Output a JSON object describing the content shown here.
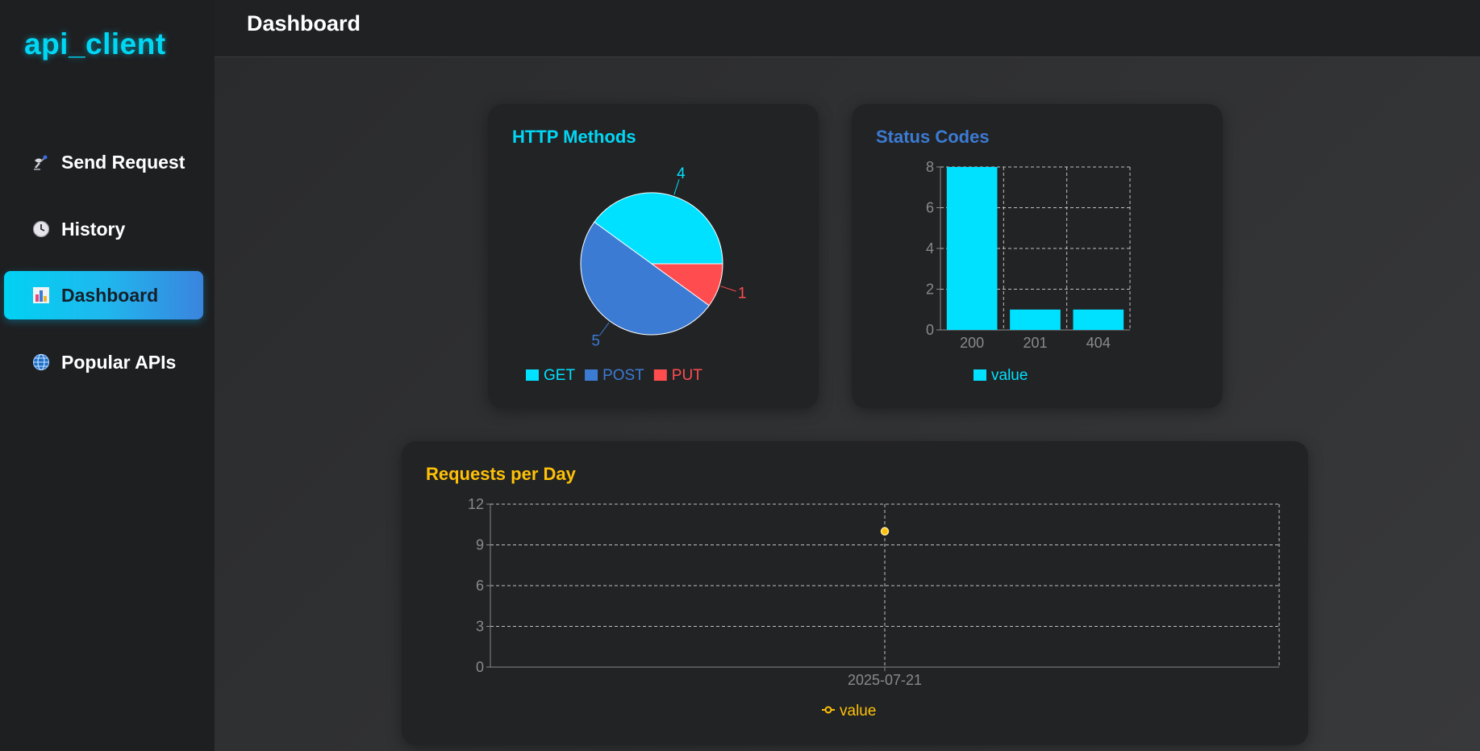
{
  "app": {
    "logo": "api_client",
    "page_title": "Dashboard"
  },
  "sidebar": {
    "items": [
      {
        "label": "Send Request",
        "icon": "satellite-dish-icon",
        "active": false
      },
      {
        "label": "History",
        "icon": "clock-icon",
        "active": false
      },
      {
        "label": "Dashboard",
        "icon": "bar-chart-icon",
        "active": true
      },
      {
        "label": "Popular APIs",
        "icon": "globe-icon",
        "active": false
      }
    ]
  },
  "colors": {
    "accent_cyan": "#00e1ff",
    "accent_blue": "#3c7bd4",
    "accent_red": "#ff4d4f",
    "accent_yellow": "#ffc107"
  },
  "cards": {
    "methods_title": "HTTP Methods",
    "status_title": "Status Codes",
    "requests_title": "Requests per Day"
  },
  "chart_data": [
    {
      "type": "pie",
      "title": "HTTP Methods",
      "slices": [
        {
          "label": "GET",
          "value": 4,
          "color": "#00e1ff"
        },
        {
          "label": "POST",
          "value": 5,
          "color": "#3c7bd4"
        },
        {
          "label": "PUT",
          "value": 1,
          "color": "#ff4d4f"
        }
      ],
      "legend": "bottom"
    },
    {
      "type": "bar",
      "title": "Status Codes",
      "categories": [
        "200",
        "201",
        "404"
      ],
      "series": [
        {
          "name": "value",
          "values": [
            8,
            1,
            1
          ],
          "color": "#00e1ff"
        }
      ],
      "ylim": [
        0,
        8
      ],
      "yticks": [
        0,
        2,
        4,
        6,
        8
      ],
      "grid": true,
      "legend": "bottom"
    },
    {
      "type": "line",
      "title": "Requests per Day",
      "x": [
        "2025-07-21"
      ],
      "series": [
        {
          "name": "value",
          "values": [
            10
          ],
          "color": "#ffc107"
        }
      ],
      "ylim": [
        0,
        12
      ],
      "yticks": [
        0,
        3,
        6,
        9,
        12
      ],
      "grid": true,
      "legend": "bottom"
    }
  ]
}
